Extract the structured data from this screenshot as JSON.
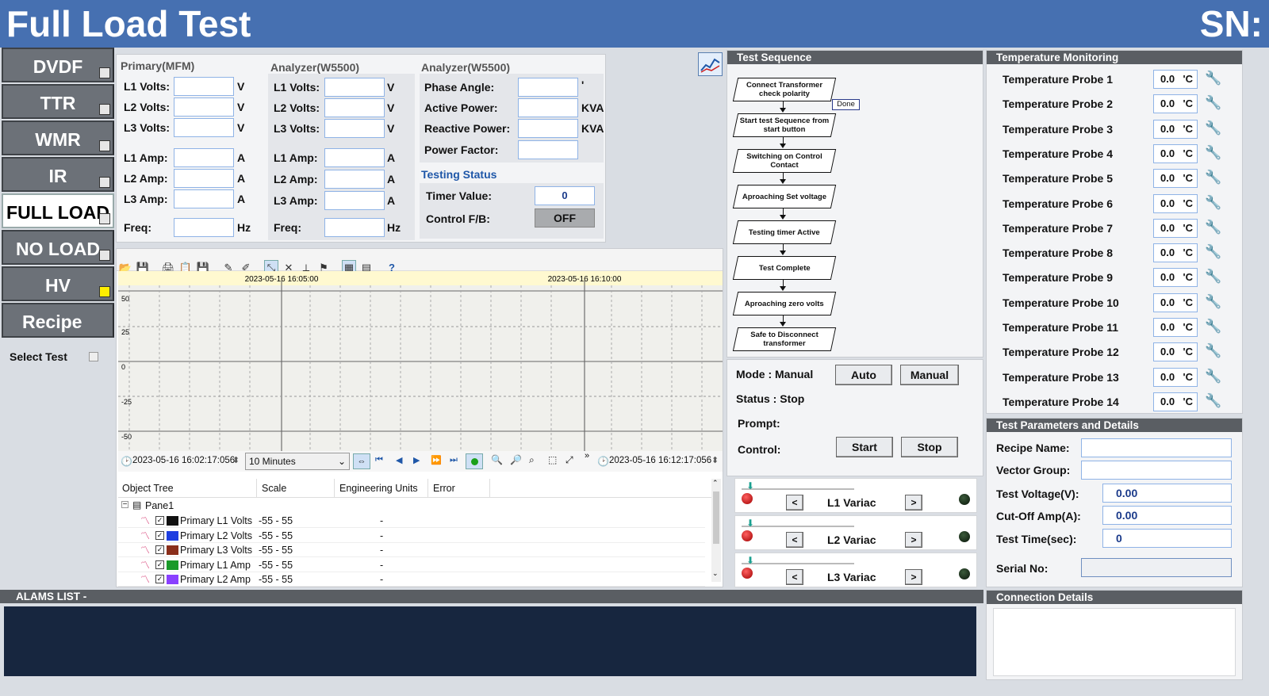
{
  "header": {
    "title": "Full Load Test",
    "sn_label": "SN:"
  },
  "nav": {
    "items": [
      {
        "label": "DVDF",
        "active": false,
        "indicator": "grey"
      },
      {
        "label": "TTR",
        "active": false,
        "indicator": "grey"
      },
      {
        "label": "WMR",
        "active": false,
        "indicator": "grey"
      },
      {
        "label": "IR",
        "active": false,
        "indicator": "grey"
      },
      {
        "label": "FULL LOAD",
        "active": true,
        "indicator": "grey"
      },
      {
        "label": "NO LOAD",
        "active": false,
        "indicator": "grey"
      },
      {
        "label": "HV",
        "active": false,
        "indicator": "yellow"
      },
      {
        "label": "Recipe",
        "active": false,
        "indicator": "none"
      }
    ],
    "select_test": "Select Test"
  },
  "meters": {
    "primary": {
      "title": "Primary(MFM)",
      "l1v": "L1 Volts:",
      "l2v": "L2 Volts:",
      "l3v": "L3 Volts:",
      "l1a": "L1 Amp:",
      "l2a": "L2 Amp:",
      "l3a": "L3 Amp:",
      "freq": "Freq:",
      "u_v": "V",
      "u_a": "A",
      "u_hz": "Hz"
    },
    "analyzer1": {
      "title": "Analyzer(W5500)",
      "l1v": "L1 Volts:",
      "l2v": "L2 Volts:",
      "l3v": "L3 Volts:",
      "l1a": "L1 Amp:",
      "l2a": "L2 Amp:",
      "l3a": "L3 Amp:",
      "freq": "Freq:",
      "u_v": "V",
      "u_a": "A",
      "u_hz": "Hz"
    },
    "analyzer2": {
      "title": "Analyzer(W5500)",
      "phase": "Phase Angle:",
      "phase_unit": "'",
      "active": "Active Power:",
      "active_unit": "KVA",
      "reactive": "Reactive Power:",
      "reactive_unit": "KVA",
      "pf": "Power Factor:"
    },
    "testing_status": {
      "title": "Testing Status",
      "timer_label": "Timer Value:",
      "timer_value": "0",
      "control_label": "Control F/B:",
      "control_value": "OFF"
    }
  },
  "chart": {
    "time_labels": [
      "2023-05-16 16:05:00",
      "2023-05-16 16:10:00"
    ],
    "y_ticks": [
      "50",
      "25",
      "0",
      "-25",
      "-50"
    ],
    "start_time": "2023-05-16 16:02:17:056",
    "end_time": "2023-05-16 16:12:17:056",
    "range": "10 Minutes",
    "more": "»",
    "tree_headers": [
      "Object Tree",
      "Scale",
      "Engineering Units",
      "Error"
    ],
    "pane": "Pane1",
    "series": [
      {
        "name": "Primary L1 Volts",
        "scale": "-55 - 55",
        "units": "-",
        "color": "#111111"
      },
      {
        "name": "Primary L2 Volts",
        "scale": "-55 - 55",
        "units": "-",
        "color": "#1e3ee0"
      },
      {
        "name": "Primary L3 Volts",
        "scale": "-55 - 55",
        "units": "-",
        "color": "#8a2e1a"
      },
      {
        "name": "Primary L1 Amp",
        "scale": "-55 - 55",
        "units": "-",
        "color": "#1a9a2a"
      },
      {
        "name": "Primary L2 Amp",
        "scale": "-55 - 55",
        "units": "-",
        "color": "#8a40ff"
      }
    ]
  },
  "sequence": {
    "title": "Test Sequence",
    "done": "Done",
    "steps": [
      "Connect Transformer check polarity",
      "Start test Sequence from start button",
      "Switching on Control Contact",
      "Aproaching Set voltage",
      "Testing timer Active",
      "Test Complete",
      "Aproaching zero volts",
      "Safe to Disconnect transformer"
    ]
  },
  "mode": {
    "mode_text": "Mode : Manual",
    "status_text": "Status : Stop",
    "prompt": "Prompt:",
    "control": "Control:",
    "auto": "Auto",
    "manual": "Manual",
    "start": "Start",
    "stop": "Stop"
  },
  "variacs": [
    {
      "label": "L1 Variac",
      "prev": "<",
      "next": ">"
    },
    {
      "label": "L2 Variac",
      "prev": "<",
      "next": ">"
    },
    {
      "label": "L3 Variac",
      "prev": "<",
      "next": ">"
    }
  ],
  "temperature": {
    "title": "Temperature Monitoring",
    "unit": "'C",
    "probes": [
      {
        "label": "Temperature Probe 1",
        "value": "0.0"
      },
      {
        "label": "Temperature Probe 2",
        "value": "0.0"
      },
      {
        "label": "Temperature Probe 3",
        "value": "0.0"
      },
      {
        "label": "Temperature Probe 4",
        "value": "0.0"
      },
      {
        "label": "Temperature Probe 5",
        "value": "0.0"
      },
      {
        "label": "Temperature Probe 6",
        "value": "0.0"
      },
      {
        "label": "Temperature Probe 7",
        "value": "0.0"
      },
      {
        "label": "Temperature Probe 8",
        "value": "0.0"
      },
      {
        "label": "Temperature Probe 9",
        "value": "0.0"
      },
      {
        "label": "Temperature Probe 10",
        "value": "0.0"
      },
      {
        "label": "Temperature Probe 11",
        "value": "0.0"
      },
      {
        "label": "Temperature Probe 12",
        "value": "0.0"
      },
      {
        "label": "Temperature Probe 13",
        "value": "0.0"
      },
      {
        "label": "Temperature Probe 14",
        "value": "0.0"
      }
    ]
  },
  "params": {
    "title": "Test Parameters and Details",
    "recipe_label": "Recipe Name:",
    "recipe_value": "",
    "vector_label": "Vector Group:",
    "vector_value": "",
    "voltage_label": "Test Voltage(V):",
    "voltage_value": "0.00",
    "cutoff_label": "Cut-Off Amp(A):",
    "cutoff_value": "0.00",
    "time_label": "Test Time(sec):",
    "time_value": "0",
    "serial_label": "Serial No:"
  },
  "alarms": {
    "title": "ALAMS LIST -"
  },
  "connection": {
    "title": "Connection Details"
  }
}
